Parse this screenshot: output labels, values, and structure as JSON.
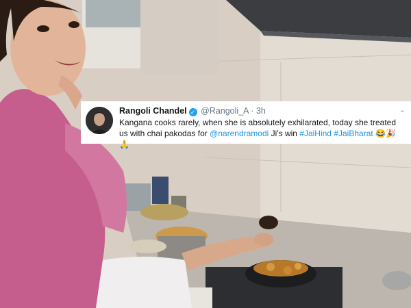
{
  "tweet": {
    "name": "Rangoli Chandel",
    "handle": "@Rangoli_A",
    "separator": "·",
    "time": "3h",
    "text_1": "Kangana cooks rarely, when she is absolutely exhilarated, today she treated us with chai pakodas for ",
    "mention": "@narendramodi",
    "text_2": " Ji's  win ",
    "hashtag_1": "#JaiHind",
    "hashtag_2": "#JaiBharat",
    "emoji_1": "😂",
    "emoji_2": "🎉",
    "emoji_3": "🙏",
    "verified_glyph": "✓",
    "caret_glyph": "⌄"
  },
  "colors": {
    "link_blue": "#1b95e0",
    "verified_blue": "#1da1f2",
    "dupatta_pink": "#c9638f",
    "kitchen_wall": "#ddd4ca"
  }
}
